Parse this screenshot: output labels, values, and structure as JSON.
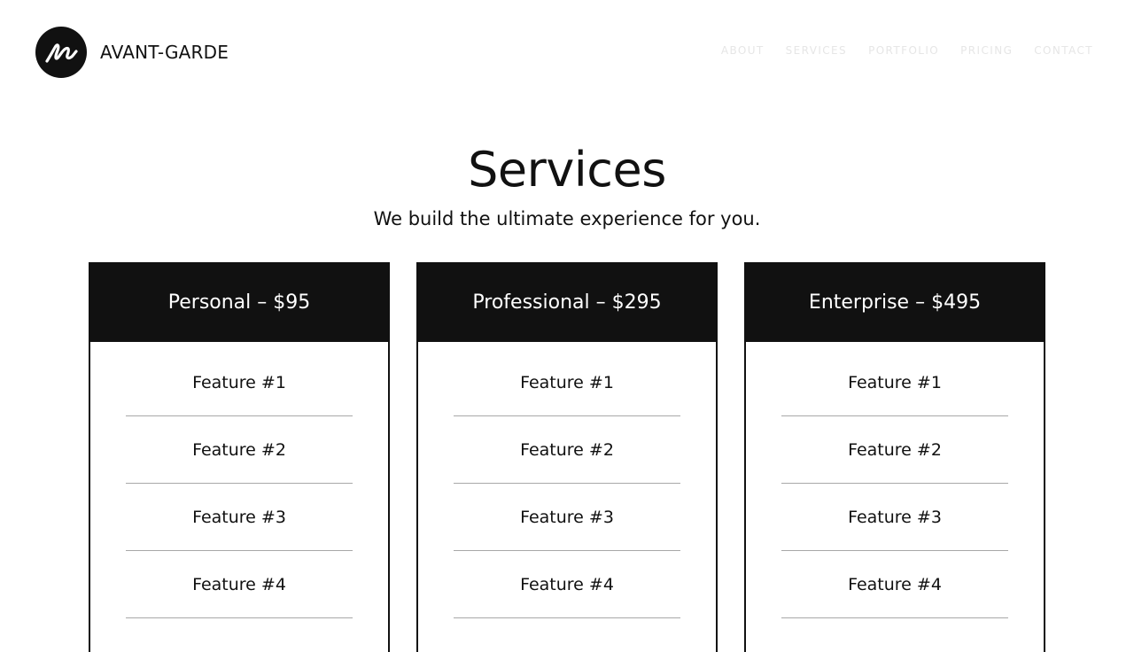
{
  "header": {
    "brand": "AVANT-GARDE",
    "logo_icon": "signature-n-icon",
    "nav": [
      "ABOUT",
      "SERVICES",
      "PORTFOLIO",
      "PRICING",
      "CONTACT"
    ]
  },
  "hero": {
    "title": "Services",
    "subtitle": "We build the ultimate experience for you."
  },
  "plans": [
    {
      "title": "Personal – $95",
      "features": [
        "Feature #1",
        "Feature #2",
        "Feature #3",
        "Feature #4"
      ]
    },
    {
      "title": "Professional – $295",
      "features": [
        "Feature #1",
        "Feature #2",
        "Feature #3",
        "Feature #4"
      ]
    },
    {
      "title": "Enterprise – $495",
      "features": [
        "Feature #1",
        "Feature #2",
        "Feature #3",
        "Feature #4"
      ]
    }
  ],
  "colors": {
    "primary": "#111111",
    "background": "#ffffff",
    "nav_text": "#e6e6e6",
    "divider": "#a8a8a8"
  }
}
